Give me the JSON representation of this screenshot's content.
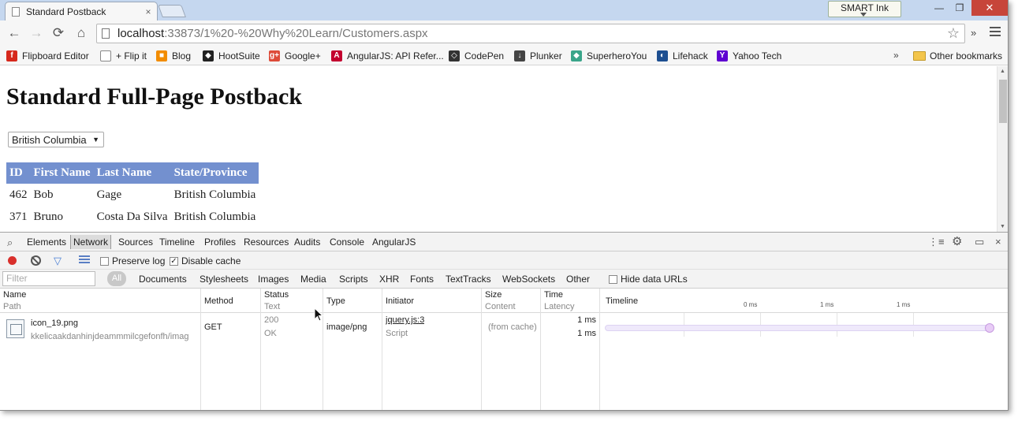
{
  "browser": {
    "tab_title": "Standard Postback",
    "tab_close": "×",
    "smart_ink": "SMART Ink",
    "window_controls": {
      "minimize": "—",
      "maximize": "❐",
      "close": "✕"
    },
    "nav": {
      "back": "←",
      "forward": "→",
      "reload": "⟳",
      "home": "⌂"
    },
    "url_host": "localhost",
    "url_path": ":33873/1%20-%20Why%20Learn/Customers.aspx",
    "star": "☆",
    "extensions_chevron": "»"
  },
  "bookmarks": {
    "items": [
      {
        "label": "Flipboard Editor",
        "icon": "flipboard-icon",
        "color": "#d6281c",
        "glyph": "f"
      },
      {
        "label": "+ Flip it",
        "icon": "page-icon",
        "color": "#ffffff",
        "glyph": ""
      },
      {
        "label": "Blog",
        "icon": "windows-icon",
        "color": "#f28c00",
        "glyph": "■"
      },
      {
        "label": "HootSuite",
        "icon": "owl-icon",
        "color": "#222222",
        "glyph": "◆"
      },
      {
        "label": "Google+",
        "icon": "googleplus-icon",
        "color": "#dd4b39",
        "glyph": "g+"
      },
      {
        "label": "AngularJS: API Refer...",
        "icon": "angular-icon",
        "color": "#c3002f",
        "glyph": "A"
      },
      {
        "label": "CodePen",
        "icon": "codepen-icon",
        "color": "#333333",
        "glyph": "◇"
      },
      {
        "label": "Plunker",
        "icon": "plunker-icon",
        "color": "#444444",
        "glyph": "↓"
      },
      {
        "label": "SuperheroYou",
        "icon": "diamond-icon",
        "color": "#3aa58a",
        "glyph": "◆"
      },
      {
        "label": "Lifehack",
        "icon": "lifehack-icon",
        "color": "#1d4f91",
        "glyph": "◐"
      },
      {
        "label": "Yahoo Tech",
        "icon": "yahoo-icon",
        "color": "#5f01d1",
        "glyph": "Y"
      }
    ],
    "more": "»",
    "other": "Other bookmarks"
  },
  "page": {
    "title": "Standard Full-Page Postback",
    "select_value": "British Columbia",
    "select_arrow": "▼",
    "table": {
      "headers": [
        "ID",
        "First Name",
        "Last Name",
        "State/Province"
      ],
      "rows": [
        [
          "462",
          "Bob",
          "Gage",
          "British Columbia"
        ],
        [
          "371",
          "Bruno",
          "Costa Da Silva",
          "British Columbia"
        ]
      ]
    }
  },
  "devtools": {
    "search_icon": "⌕",
    "tabs": [
      "Elements",
      "Network",
      "Sources",
      "Timeline",
      "Profiles",
      "Resources",
      "Audits",
      "Console",
      "AngularJS"
    ],
    "active_tab": "Network",
    "right_icons": {
      "drawer": "⋮≡",
      "settings": "⚙",
      "dock": "▭",
      "close": "×"
    },
    "preserve_log": "Preserve log",
    "disable_cache": "Disable cache",
    "disable_cache_checked": "✓",
    "filter_placeholder": "Filter",
    "all_label": "All",
    "type_filters": [
      "Documents",
      "Stylesheets",
      "Images",
      "Media",
      "Scripts",
      "XHR",
      "Fonts",
      "TextTracks",
      "WebSockets",
      "Other"
    ],
    "hide_data_urls": "Hide data URLs",
    "columns": {
      "name": {
        "title": "Name",
        "sub": "Path"
      },
      "method": {
        "title": "Method"
      },
      "status": {
        "title": "Status",
        "sub": "Text"
      },
      "type": {
        "title": "Type"
      },
      "initiator": {
        "title": "Initiator"
      },
      "size": {
        "title": "Size",
        "sub": "Content"
      },
      "time": {
        "title": "Time",
        "sub": "Latency"
      },
      "timeline": {
        "title": "Timeline",
        "ticks": [
          "0 ms",
          "1 ms",
          "1 ms"
        ]
      }
    },
    "request": {
      "name": "icon_19.png",
      "path": "kkelicaakdanhinjdeammmilcgefonfh/imag",
      "method": "GET",
      "status": "200",
      "status_text": "OK",
      "type": "image/png",
      "initiator": "jquery.js:3",
      "initiator_type": "Script",
      "size": "(from cache)",
      "time": "1 ms",
      "latency": "1 ms"
    }
  }
}
